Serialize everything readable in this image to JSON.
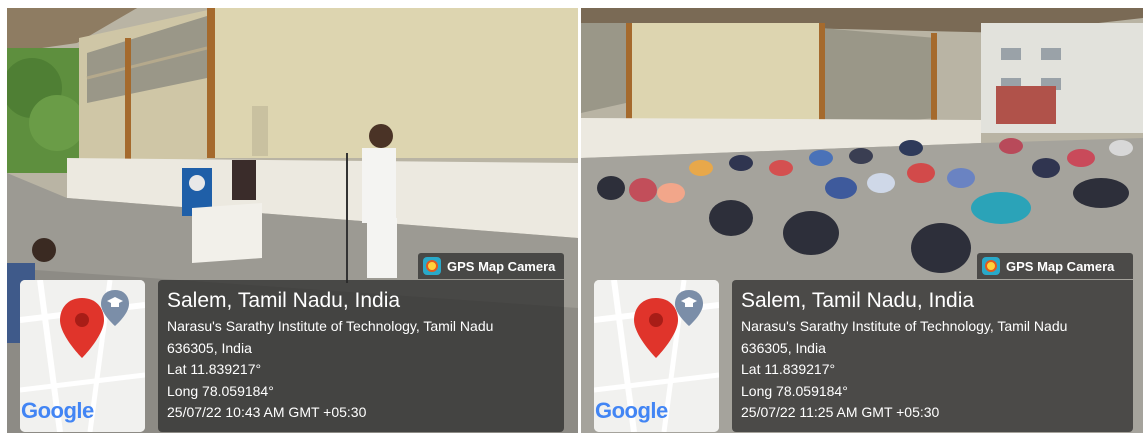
{
  "photos": [
    {
      "badge_label": "GPS Map Camera",
      "map_logo": "Google",
      "location_title": "Salem, Tamil Nadu, India",
      "address_line1": "Narasu's Sarathy Institute of Technology, Tamil Nadu",
      "address_line2": "636305, India",
      "latitude": "Lat 11.839217°",
      "longitude": "Long 78.059184°",
      "timestamp": "25/07/22 10:43 AM GMT +05:30"
    },
    {
      "badge_label": "GPS Map Camera",
      "map_logo": "Google",
      "location_title": "Salem, Tamil Nadu, India",
      "address_line1": "Narasu's Sarathy Institute of Technology, Tamil Nadu",
      "address_line2": "636305, India",
      "latitude": "Lat 11.839217°",
      "longitude": "Long 78.059184°",
      "timestamp": "25/07/22 11:25 AM GMT +05:30"
    }
  ],
  "colors": {
    "overlay": "#282828",
    "map_pin": "#e0342b",
    "map_cap_pin": "#7b8ea8",
    "badge_icon": "#29a9c9"
  },
  "icons": [
    "gps-camera-icon",
    "map-pin-icon",
    "graduation-cap-icon"
  ]
}
